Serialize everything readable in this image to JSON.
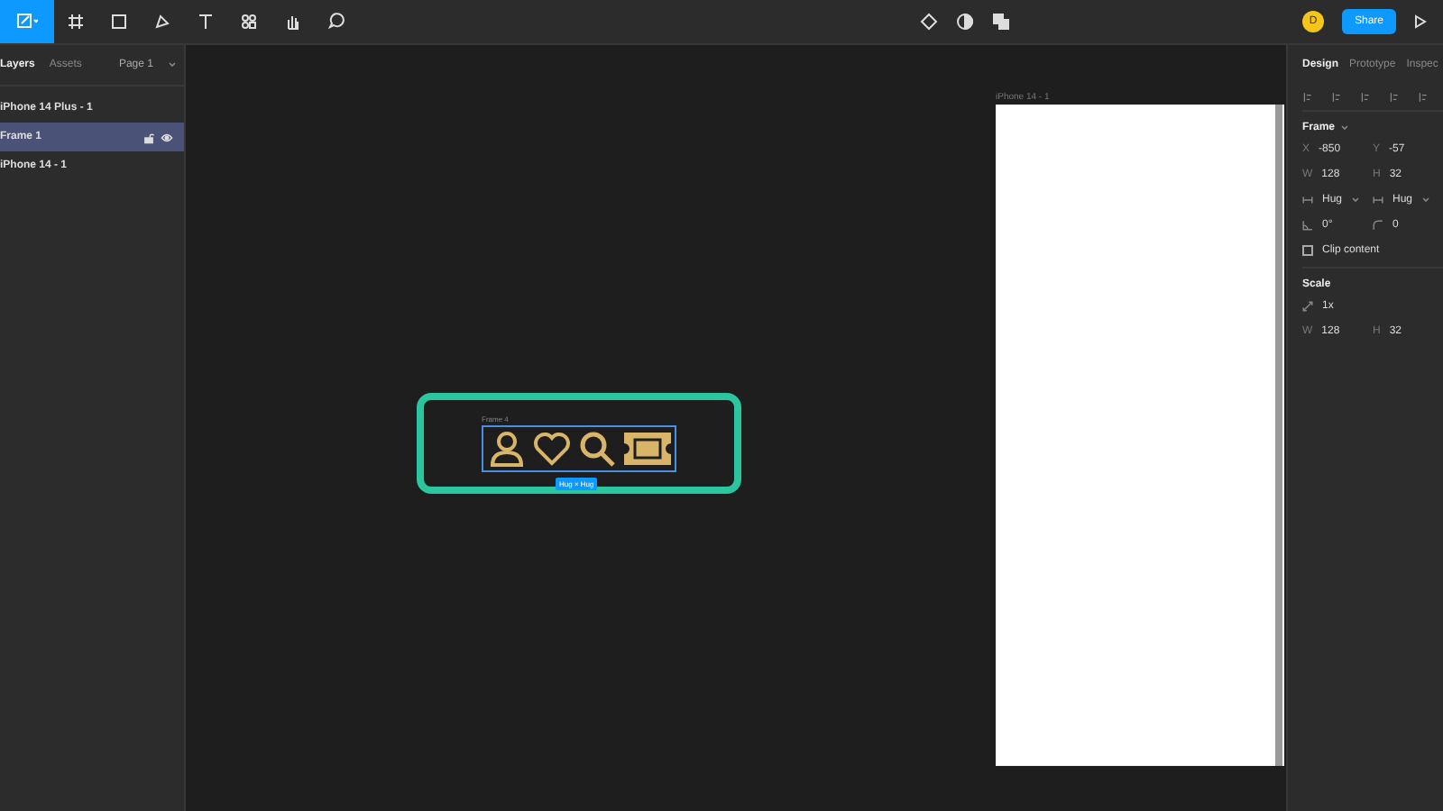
{
  "toolbar": {
    "avatar": "D",
    "share": "Share"
  },
  "left_panel": {
    "tabs": [
      {
        "label": "Layers",
        "selected": true
      },
      {
        "label": "Assets",
        "selected": false
      }
    ],
    "page": "Page 1",
    "layers": [
      {
        "name": "iPhone 14 Plus - 1",
        "selected": false
      },
      {
        "name": "Frame 1",
        "selected": true
      },
      {
        "name": "iPhone 14 - 1",
        "selected": false
      }
    ]
  },
  "canvas": {
    "frame_label": "Frame 4",
    "size_badge": "Hug × Hug",
    "phone_label": "iPhone 14 - 1"
  },
  "right_panel": {
    "tabs": [
      {
        "label": "Design",
        "selected": true
      },
      {
        "label": "Prototype",
        "selected": false
      },
      {
        "label": "Inspec",
        "selected": false
      }
    ],
    "frame_title": "Frame",
    "fields": [
      {
        "label": "X",
        "value": "-850"
      },
      {
        "label": "Y",
        "value": "-57"
      },
      {
        "label": "W",
        "value": "128"
      },
      {
        "label": "H",
        "value": "32"
      }
    ],
    "resizing": [
      {
        "value": "Hug"
      },
      {
        "value": "Hug"
      }
    ],
    "rotation": "0°",
    "radius": "0",
    "clip_content": {
      "label": "Clip content",
      "checked": false
    },
    "scale_title": "Scale",
    "scale": "1x",
    "scale_fields": [
      {
        "label": "W",
        "value": "128"
      },
      {
        "label": "H",
        "value": "32"
      }
    ]
  }
}
